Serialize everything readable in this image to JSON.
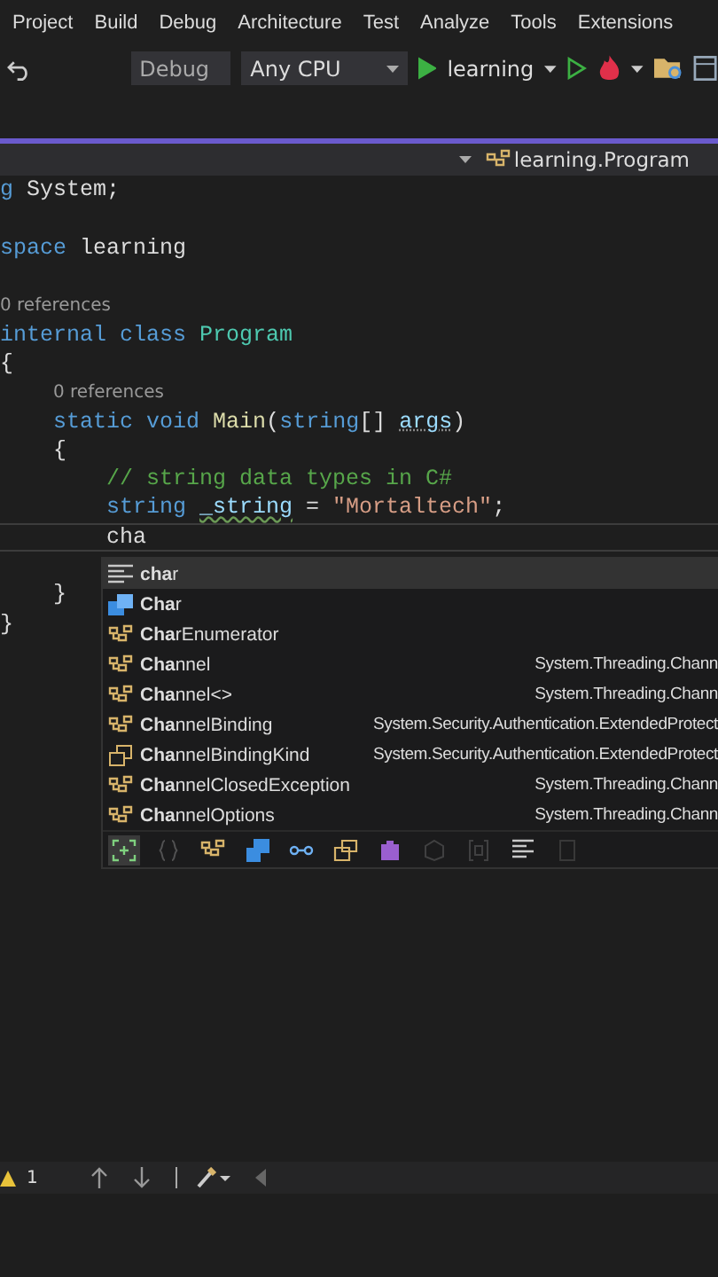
{
  "menu": [
    "Project",
    "Build",
    "Debug",
    "Architecture",
    "Test",
    "Analyze",
    "Tools",
    "Extensions"
  ],
  "toolbar": {
    "configuration": "Debug",
    "platform": "Any CPU",
    "startup": "learning"
  },
  "navigation": {
    "member": "learning.Program"
  },
  "code": [
    {
      "kind": "code",
      "tokens": [
        {
          "text": "g",
          "kind": "kw"
        },
        {
          "text": " System;",
          "kind": "plain"
        }
      ]
    },
    {
      "kind": "blank"
    },
    {
      "kind": "code",
      "tokens": [
        {
          "text": "space",
          "kind": "kw"
        },
        {
          "text": " learning",
          "kind": "plain"
        }
      ],
      "children": [
        {
          "kind": "blank"
        },
        {
          "kind": "codelens",
          "text": "0 references"
        },
        {
          "kind": "code",
          "tokens": [
            {
              "text": "internal ",
              "kind": "kw"
            },
            {
              "text": "class ",
              "kind": "kw"
            },
            {
              "text": "Program",
              "kind": "type"
            }
          ]
        },
        {
          "kind": "code",
          "tokens": [
            {
              "text": "{",
              "kind": "plain"
            }
          ],
          "children": [
            {
              "kind": "codelens",
              "text": "0 references"
            },
            {
              "kind": "code",
              "tokens": [
                {
                  "text": "static ",
                  "kind": "kw"
                },
                {
                  "text": "void ",
                  "kind": "kw"
                },
                {
                  "text": "Main",
                  "kind": "method"
                },
                {
                  "text": "(",
                  "kind": "plain"
                },
                {
                  "text": "string",
                  "kind": "kw"
                },
                {
                  "text": "[] ",
                  "kind": "plain"
                },
                {
                  "text": "args",
                  "kind": "param"
                },
                {
                  "text": ")",
                  "kind": "plain"
                }
              ]
            },
            {
              "kind": "code",
              "tokens": [
                {
                  "text": "{",
                  "kind": "plain"
                }
              ],
              "children": [
                {
                  "kind": "code",
                  "tokens": [
                    {
                      "text": "// string data types in C#",
                      "kind": "comment"
                    }
                  ]
                },
                {
                  "kind": "code",
                  "tokens": [
                    {
                      "text": "string ",
                      "kind": "kw"
                    },
                    {
                      "text": "_string",
                      "kind": "squiggle"
                    },
                    {
                      "text": " = ",
                      "kind": "plain"
                    },
                    {
                      "text": "\"Mortaltech\"",
                      "kind": "string"
                    },
                    {
                      "text": ";",
                      "kind": "plain"
                    }
                  ]
                },
                {
                  "kind": "current",
                  "tokens": [
                    {
                      "text": "cha",
                      "kind": "plain"
                    }
                  ]
                },
                {
                  "kind": "blank"
                }
              ]
            },
            {
              "kind": "code",
              "tokens": [
                {
                  "text": "}",
                  "kind": "plain"
                }
              ]
            }
          ]
        },
        {
          "kind": "code",
          "tokens": [
            {
              "text": "}",
              "kind": "plain"
            }
          ]
        }
      ]
    }
  ],
  "completion": {
    "items": [
      {
        "kind": "keyword",
        "name": "**cha**r",
        "selected": true
      },
      {
        "kind": "struct",
        "name": "**Cha**r",
        "selected": false
      },
      {
        "kind": "class",
        "name": "**Cha**rEnumerator",
        "selected": false
      },
      {
        "kind": "class",
        "name": "**Cha**nnel",
        "namespace": "System.Threading.Chann",
        "selected": false
      },
      {
        "kind": "class",
        "name": "**Cha**nnel<>",
        "namespace": "System.Threading.Chann",
        "selected": false
      },
      {
        "kind": "class",
        "name": "**Cha**nnelBinding",
        "namespace": "System.Security.Authentication.ExtendedProtect",
        "selected": false
      },
      {
        "kind": "enum",
        "name": "**Cha**nnelBindingKind",
        "namespace": "System.Security.Authentication.ExtendedProtect",
        "selected": false
      },
      {
        "kind": "class",
        "name": "**Cha**nnelClosedException",
        "namespace": "System.Threading.Chann",
        "selected": false
      },
      {
        "kind": "class",
        "name": "**Cha**nnelOptions",
        "namespace": "System.Threading.Chann",
        "selected": false
      }
    ],
    "filters": [
      {
        "kind": "expand",
        "on": true
      },
      {
        "kind": "braces",
        "on": false
      },
      {
        "kind": "class",
        "on": true
      },
      {
        "kind": "struct",
        "on": true
      },
      {
        "kind": "interface",
        "on": true
      },
      {
        "kind": "enum",
        "on": true
      },
      {
        "kind": "module",
        "on": true
      },
      {
        "kind": "cube",
        "on": false
      },
      {
        "kind": "bracket",
        "on": false
      },
      {
        "kind": "keyword",
        "on": true
      },
      {
        "kind": "snippet",
        "on": false
      }
    ]
  },
  "status": {
    "warnings": "1"
  }
}
